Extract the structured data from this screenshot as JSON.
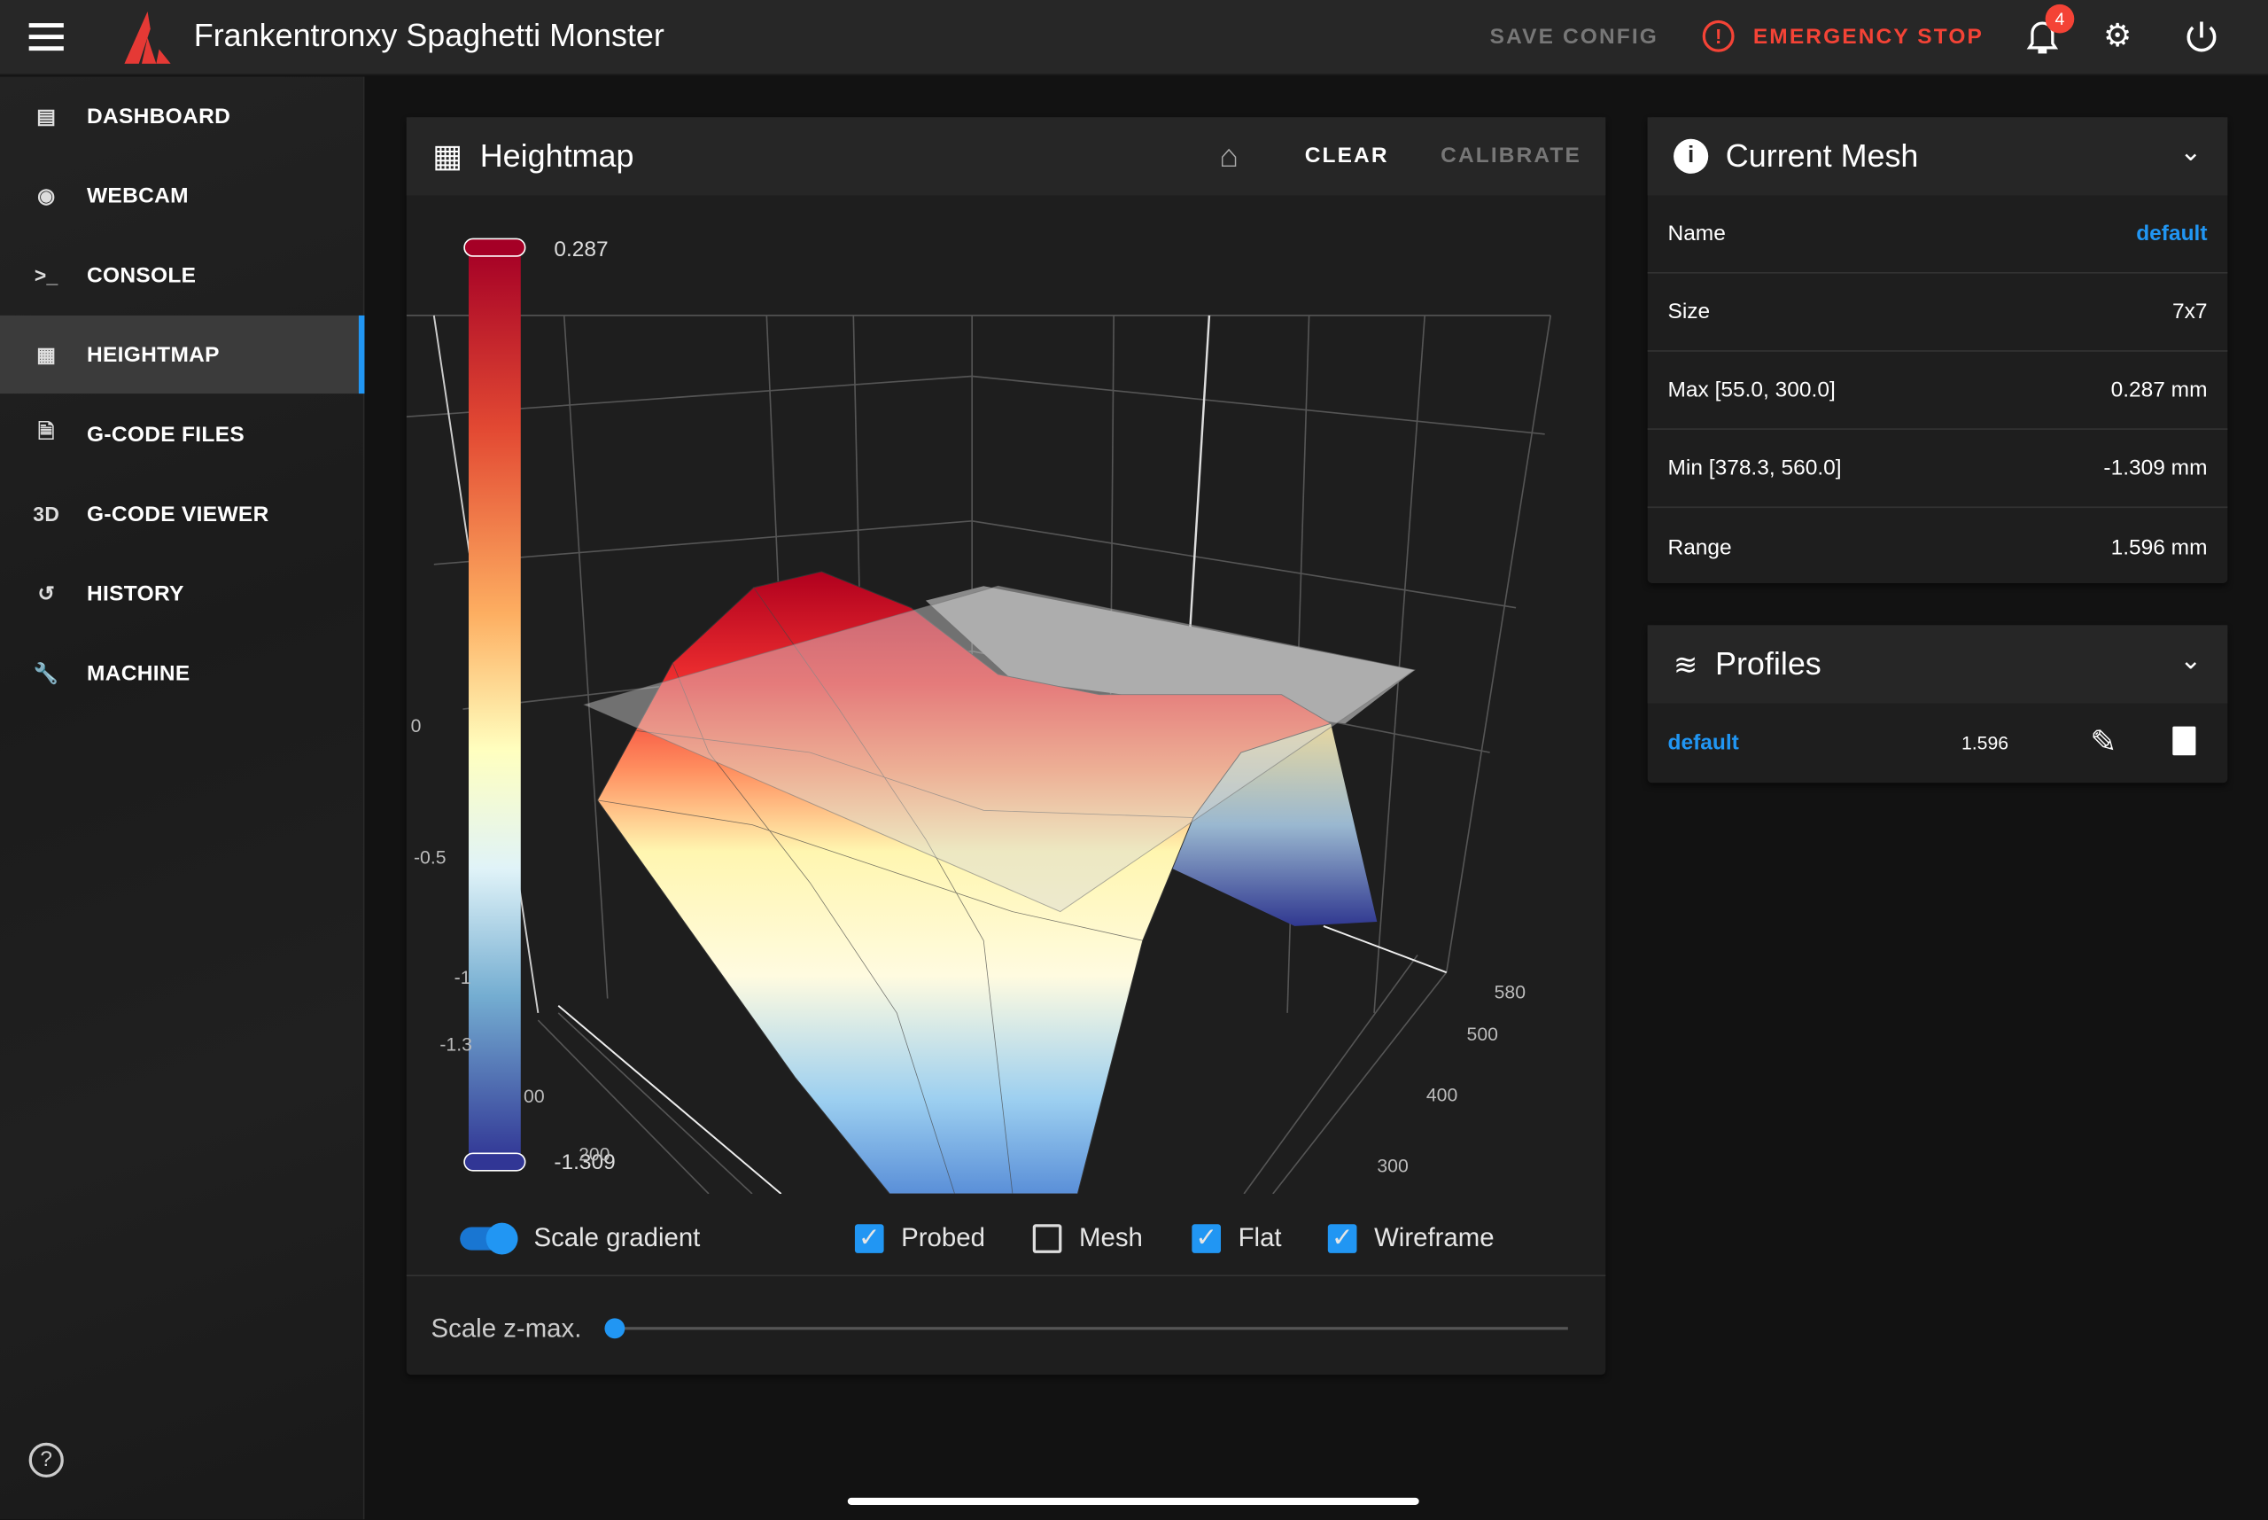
{
  "app": {
    "title": "Frankentronxy Spaghetti Monster",
    "save_config": "SAVE CONFIG",
    "emergency_stop": "EMERGENCY STOP",
    "notification_count": "4",
    "accent": "#2196f3",
    "danger": "#f44336"
  },
  "sidebar": {
    "items": [
      {
        "label": "DASHBOARD",
        "icon": "monitor-dashboard-icon"
      },
      {
        "label": "WEBCAM",
        "icon": "webcam-icon"
      },
      {
        "label": "CONSOLE",
        "icon": "console-icon"
      },
      {
        "label": "HEIGHTMAP",
        "icon": "grid-icon",
        "active": true
      },
      {
        "label": "G-CODE FILES",
        "icon": "file-document-icon"
      },
      {
        "label": "G-CODE VIEWER",
        "icon": "3d-icon",
        "glyph": "3D"
      },
      {
        "label": "HISTORY",
        "icon": "history-icon"
      },
      {
        "label": "MACHINE",
        "icon": "wrench-icon"
      }
    ]
  },
  "heightmap": {
    "title": "Heightmap",
    "clear": "CLEAR",
    "calibrate": "CALIBRATE",
    "colorbar": {
      "max": "0.287",
      "min": "-1.309"
    },
    "z_ticks": [
      "0",
      "-0.5",
      "-1",
      "-1.3"
    ],
    "x_ticks": [
      "00",
      "200"
    ],
    "y_ticks": [
      "580",
      "500",
      "400",
      "300"
    ],
    "options": {
      "scale_gradient": {
        "label": "Scale gradient",
        "on": true
      },
      "probed": {
        "label": "Probed",
        "checked": true
      },
      "mesh": {
        "label": "Mesh",
        "checked": false
      },
      "flat": {
        "label": "Flat",
        "checked": true
      },
      "wireframe": {
        "label": "Wireframe",
        "checked": true
      }
    },
    "scale_zmax": {
      "label": "Scale z-max.",
      "value": 0
    }
  },
  "current_mesh": {
    "title": "Current Mesh",
    "rows": [
      {
        "label": "Name",
        "value": "default"
      },
      {
        "label": "Size",
        "value": "7x7"
      },
      {
        "label": "Max [55.0, 300.0]",
        "value": "0.287 mm"
      },
      {
        "label": "Min [378.3, 560.0]",
        "value": "-1.309 mm"
      },
      {
        "label": "Range",
        "value": "1.596 mm"
      }
    ]
  },
  "profiles": {
    "title": "Profiles",
    "items": [
      {
        "name": "default",
        "range": "1.596"
      }
    ]
  }
}
